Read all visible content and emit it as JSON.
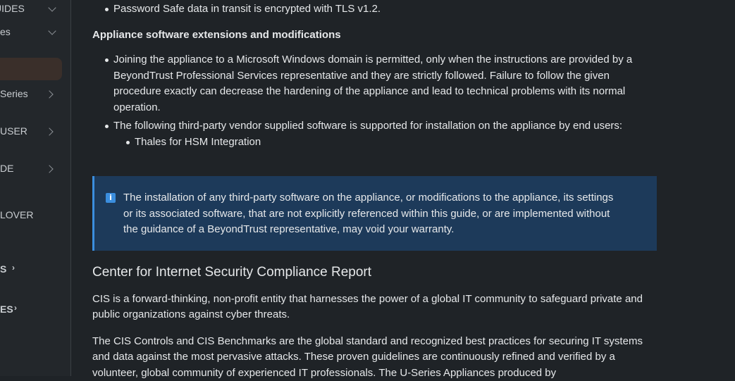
{
  "sidebar": {
    "items": [
      {
        "label": "UIDES",
        "chevron": "down"
      },
      {
        "label": "es",
        "chevron": "down"
      },
      {
        "label": "",
        "active": true
      },
      {
        "label": "Series",
        "chevron": "right"
      },
      {
        "label": "USER",
        "chevron": "right"
      },
      {
        "label": "DE",
        "chevron": "right"
      },
      {
        "label": "LOVER",
        "chevron": ""
      },
      {
        "label": "S",
        "chevron": "›"
      },
      {
        "label": "ES",
        "chevron": "›"
      }
    ]
  },
  "main": {
    "top_bullet": "Password Safe data in transit is encrypted with TLS v1.2.",
    "extensions_heading": "Appliance software extensions and modifications",
    "extension_bullets": [
      "Joining the appliance to a Microsoft Windows domain is permitted, only when the instructions are provided by a BeyondTrust Professional Services representative and they are strictly followed. Failure to follow the given procedure exactly can decrease the hardening of the appliance and lead to technical problems with its normal operation.",
      "The following third-party vendor supplied software is supported for installation on the appliance by end users:"
    ],
    "sub_bullet": "Thales for HSM Integration",
    "callout": {
      "icon": "info-icon",
      "text": "The installation of any third-party software on the appliance, or modifications to the appliance, its settings or its associated software, that are not explicitly referenced within this guide, or are implemented without the guidance of a BeyondTrust representative, may void your warranty."
    },
    "cis_heading": "Center for Internet Security Compliance Report",
    "cis_para1": "CIS is a forward-thinking, non-profit entity that harnesses the power of a global IT community to safeguard private and public organizations against cyber threats.",
    "cis_para2": "The CIS Controls and CIS Benchmarks are the global standard and recognized best practices for securing IT systems and data against the most pervasive attacks. These proven guidelines are continuously refined and verified by a volunteer, global community of experienced IT professionals. The U-Series Appliances produced by"
  },
  "colors": {
    "background": "#1f2327",
    "sidebar": "#23272b",
    "callout_bg": "#1d3a5a",
    "callout_border": "#3b8ede",
    "active_item": "#3a2f2a"
  }
}
